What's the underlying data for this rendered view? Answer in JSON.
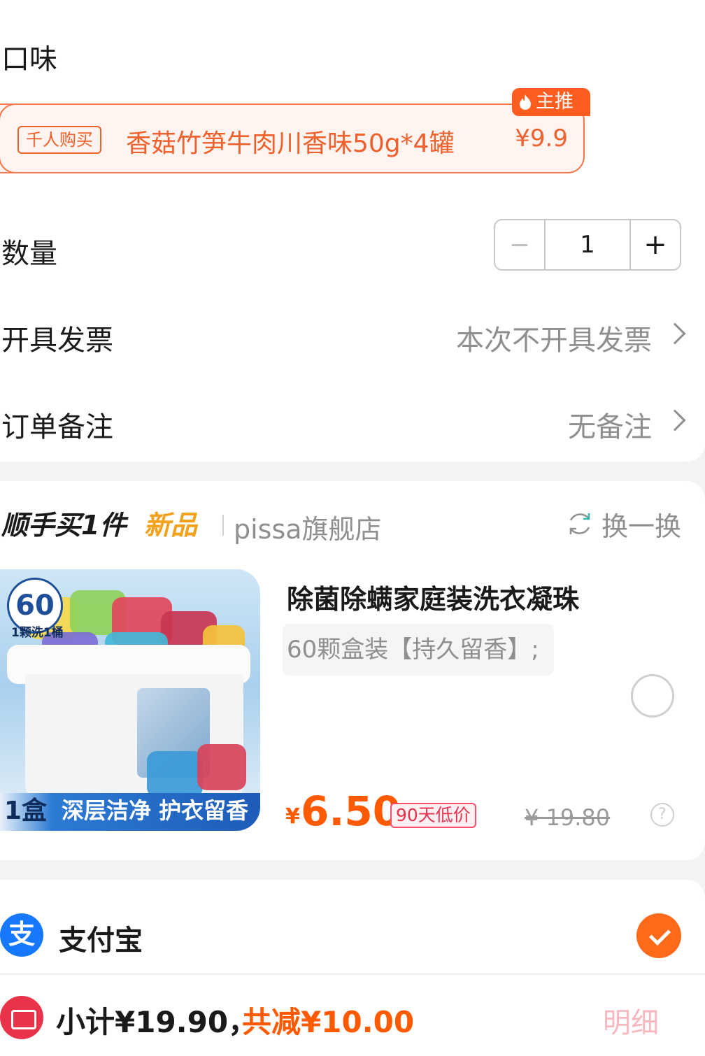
{
  "order": {
    "flavor_label": "口味",
    "flavor_option": {
      "tag": "千人购买",
      "name": "香菇竹笋牛肉川香味50g*4罐",
      "price": "¥9.9",
      "badge": "主推"
    },
    "quantity": {
      "label": "数量",
      "minus": "−",
      "value": "1",
      "plus": "+"
    },
    "invoice": {
      "label": "开具发票",
      "value": "本次不开具发票"
    },
    "note": {
      "label": "订单备注",
      "value": "无备注"
    }
  },
  "addon": {
    "title": "顺手买1件",
    "new_label": "新品",
    "store": "pissa旗舰店",
    "refresh": "换一换",
    "product": {
      "image_badge": "60",
      "image_badge_sub": "1颗洗1桶",
      "image_caption_left": "1盒",
      "image_caption_right": "深层洁净 护衣留香",
      "title": "除菌除螨家庭装洗衣凝珠",
      "variant": "60颗盒装【持久留香】;",
      "currency": "¥",
      "price": "6.50",
      "price_tag": "90天低价",
      "original_price": "¥ 19.80",
      "help": "?"
    }
  },
  "payment": {
    "method_icon": "支",
    "method": "支付宝",
    "subtotal": "小计¥19.90，",
    "discount": "共减¥10.00",
    "detail": "明细"
  },
  "colors": {
    "accent": "#ff5a00",
    "option_border": "#f4764a",
    "alipay_blue": "#1677ff",
    "check_orange": "#ff6a1a"
  }
}
